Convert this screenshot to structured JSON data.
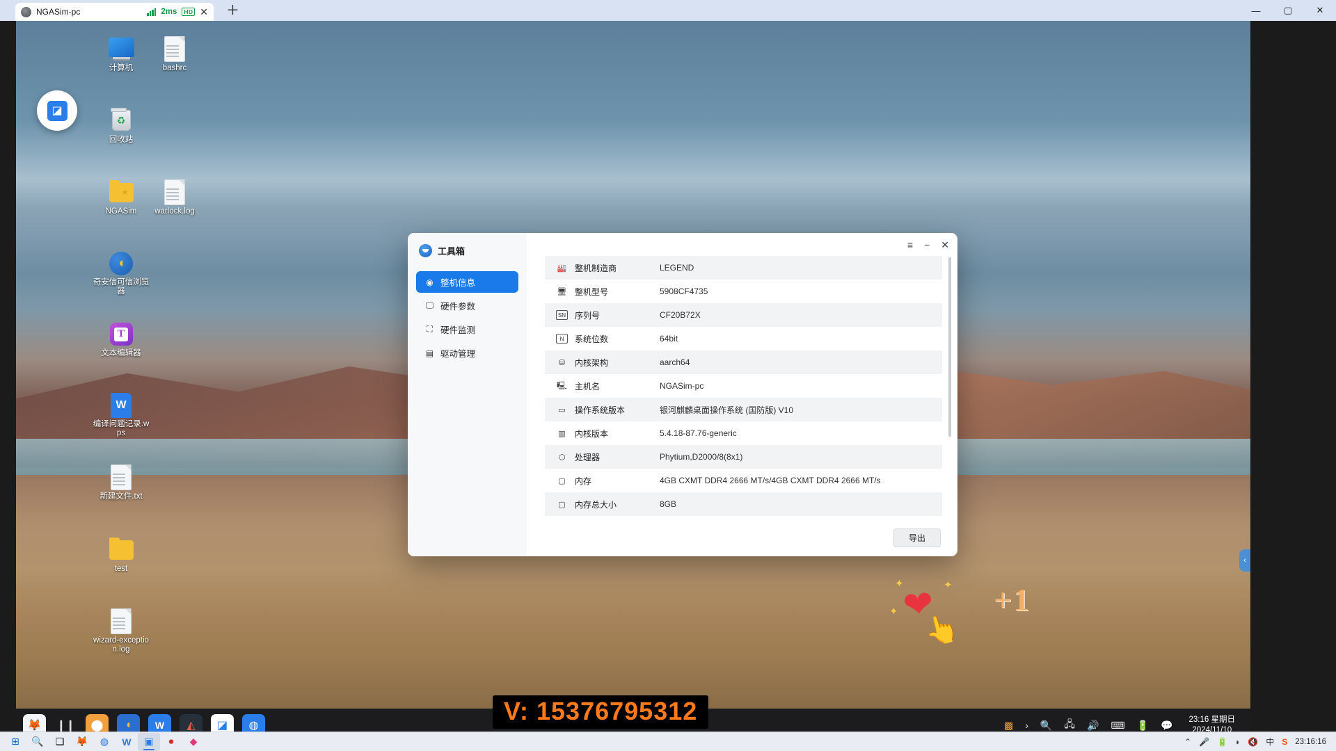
{
  "client": {
    "tab_title": "NGASim-pc",
    "latency": "2ms",
    "quality_badge": "HD",
    "close_glyph": "✕",
    "new_tab_glyph": "＋",
    "minimize_glyph": "—",
    "maximize_glyph": "▢",
    "window_close_glyph": "✕"
  },
  "desktop": {
    "icons": [
      {
        "label": "计算机",
        "type": "monitor"
      },
      {
        "label": "bashrc",
        "type": "document"
      },
      {
        "label": "回收站",
        "type": "trash"
      },
      {
        "label": "NGASim",
        "type": "folder"
      },
      {
        "label": "warlock.log",
        "type": "document"
      },
      {
        "label": "奇安信可信浏览器",
        "type": "browser"
      },
      {
        "label": "文本编辑器",
        "type": "texteditor"
      },
      {
        "label": "编译问题记录.wps",
        "type": "wps"
      },
      {
        "label": "新建文件.txt",
        "type": "document"
      },
      {
        "label": "test",
        "type": "folder-plain"
      },
      {
        "label": "wizard-exception.log",
        "type": "document"
      }
    ]
  },
  "dialog": {
    "title": "工具箱",
    "menu_glyph": "≡",
    "minimize_glyph": "−",
    "close_glyph": "✕",
    "export_label": "导出",
    "nav": [
      {
        "label": "整机信息",
        "icon": "gauge-icon",
        "glyph": "◉",
        "active": true
      },
      {
        "label": "硬件参数",
        "icon": "monitor-icon",
        "glyph": "🖵",
        "active": false
      },
      {
        "label": "硬件监测",
        "icon": "chart-icon",
        "glyph": "⛶",
        "active": false
      },
      {
        "label": "驱动管理",
        "icon": "drive-icon",
        "glyph": "▤",
        "active": false
      }
    ],
    "rows": [
      {
        "icon": "factory-icon",
        "glyph": "🏭",
        "key": "整机制造商",
        "value": "LEGEND"
      },
      {
        "icon": "device-icon",
        "glyph": "🖥",
        "key": "整机型号",
        "value": "5908CF4735"
      },
      {
        "icon": "serial-icon",
        "glyph": "SN",
        "key": "序列号",
        "value": "CF20B72X"
      },
      {
        "icon": "bits-icon",
        "glyph": "N",
        "key": "系统位数",
        "value": "64bit"
      },
      {
        "icon": "cpu-arch-icon",
        "glyph": "⛁",
        "key": "内核架构",
        "value": "aarch64"
      },
      {
        "icon": "hostname-icon",
        "glyph": "🖳",
        "key": "主机名",
        "value": "NGASim-pc"
      },
      {
        "icon": "os-icon",
        "glyph": "▭",
        "key": "操作系统版本",
        "value": "银河麒麟桌面操作系统 (国防版) V10"
      },
      {
        "icon": "kernel-icon",
        "glyph": "▥",
        "key": "内核版本",
        "value": "5.4.18-87.76-generic"
      },
      {
        "icon": "processor-icon",
        "glyph": "⬡",
        "key": "处理器",
        "value": "Phytium,D2000/8(8x1)"
      },
      {
        "icon": "memory-icon",
        "glyph": "▢",
        "key": "内存",
        "value": "4GB CXMT DDR4 2666 MT/s/4GB CXMT DDR4 2666 MT/s"
      },
      {
        "icon": "memory-total-icon",
        "glyph": "▢",
        "key": "内存总大小",
        "value": "8GB"
      }
    ]
  },
  "kylin_taskbar": {
    "apps": [
      {
        "name": "firefox",
        "glyph": "🦊",
        "bg": "#f2f4f7",
        "running": false
      },
      {
        "name": "task-view",
        "glyph": "❙❙",
        "bg": "transparent",
        "running": false
      },
      {
        "name": "app-store",
        "glyph": "⬤",
        "bg": "#f2a03d",
        "running": true
      },
      {
        "name": "qax-browser",
        "glyph": "◖",
        "bg": "#2a6fd0",
        "running": true
      },
      {
        "name": "wps-office",
        "glyph": "W",
        "bg": "#2b7de9",
        "running": true
      },
      {
        "name": "kylin-tool",
        "glyph": "◭",
        "bg": "#25303a",
        "running": true
      },
      {
        "name": "ngasim",
        "glyph": "◪",
        "bg": "#ffffff",
        "running": true
      },
      {
        "name": "toolbox",
        "glyph": "◍",
        "bg": "#2b7de9",
        "running": true
      }
    ],
    "tray": [
      {
        "name": "security-icon",
        "glyph": "▩"
      },
      {
        "name": "expand-icon",
        "glyph": "›"
      },
      {
        "name": "search-icon",
        "glyph": "🔍"
      },
      {
        "name": "network-icon",
        "glyph": "🖧"
      },
      {
        "name": "volume-icon",
        "glyph": "🔊"
      },
      {
        "name": "keyboard-icon",
        "glyph": "⌨"
      },
      {
        "name": "battery-icon",
        "glyph": "🔋"
      },
      {
        "name": "notification-icon",
        "glyph": "💬"
      }
    ],
    "clock_time": "23:16 星期日",
    "clock_date": "2024/11/10",
    "collapse_glyph": "‹"
  },
  "host_taskbar": {
    "left": [
      {
        "name": "start-button",
        "glyph": "⊞",
        "active": false
      },
      {
        "name": "search-button",
        "glyph": "🔍",
        "active": false
      },
      {
        "name": "task-view-button",
        "glyph": "❑",
        "active": false
      },
      {
        "name": "firefox-button",
        "glyph": "🦊",
        "active": false
      },
      {
        "name": "chrome-button",
        "glyph": "◍",
        "active": false
      },
      {
        "name": "wps-button",
        "glyph": "W",
        "active": false
      },
      {
        "name": "remote-desktop-button",
        "glyph": "▣",
        "active": true
      },
      {
        "name": "recorder-button",
        "glyph": "⏺",
        "active": false
      },
      {
        "name": "app-button",
        "glyph": "◆",
        "active": false
      }
    ],
    "tray": [
      {
        "name": "show-hidden-icons",
        "glyph": "⌃"
      },
      {
        "name": "microphone-icon",
        "glyph": "🎤"
      },
      {
        "name": "battery-icon",
        "glyph": "🔋"
      },
      {
        "name": "wifi-icon",
        "glyph": "◗"
      },
      {
        "name": "volume-muted-icon",
        "glyph": "🔇"
      },
      {
        "name": "ime-icon",
        "glyph": "中"
      },
      {
        "name": "sogou-icon",
        "glyph": "S"
      }
    ],
    "clock": "23:16:16"
  },
  "overlay": {
    "watermark": "V: 15376795312",
    "sticker_text": "+1",
    "heart_glyph": "❤",
    "hand_glyph": "👆"
  }
}
